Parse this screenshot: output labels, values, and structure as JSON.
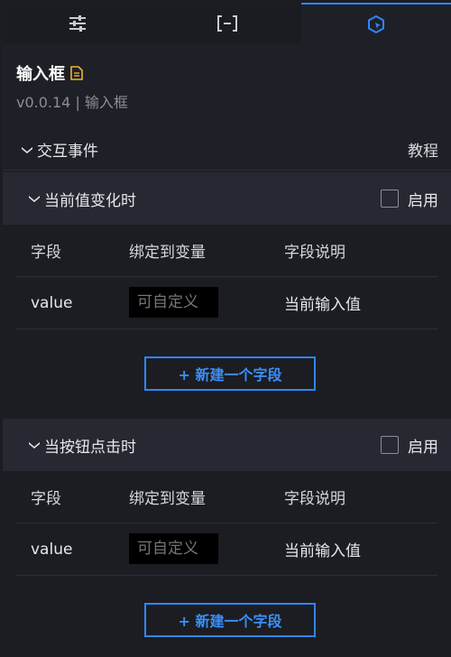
{
  "tabs": [
    {
      "name": "style",
      "icon": "sliders-icon"
    },
    {
      "name": "data",
      "icon": "bracket-icon"
    },
    {
      "name": "interaction",
      "icon": "cursor-hexagon-icon"
    }
  ],
  "component": {
    "title": "输入框",
    "subtitle": "v0.0.14 | 输入框"
  },
  "events": {
    "label": "交互事件",
    "tutorial": "教程"
  },
  "sections": [
    {
      "label": "当前值变化时",
      "enable_label": "启用",
      "columns": [
        "字段",
        "绑定到变量",
        "字段说明"
      ],
      "row": {
        "field": "value",
        "placeholder": "可自定义",
        "description": "当前输入值"
      },
      "add_label": "+ 新建一个字段"
    },
    {
      "label": "当按钮点击时",
      "enable_label": "启用",
      "columns": [
        "字段",
        "绑定到变量",
        "字段说明"
      ],
      "row": {
        "field": "value",
        "placeholder": "可自定义",
        "description": "当前输入值"
      },
      "add_label": "+ 新建一个字段"
    }
  ],
  "colors": {
    "accent": "#2f86f6",
    "title_icon": "#f0b429"
  }
}
